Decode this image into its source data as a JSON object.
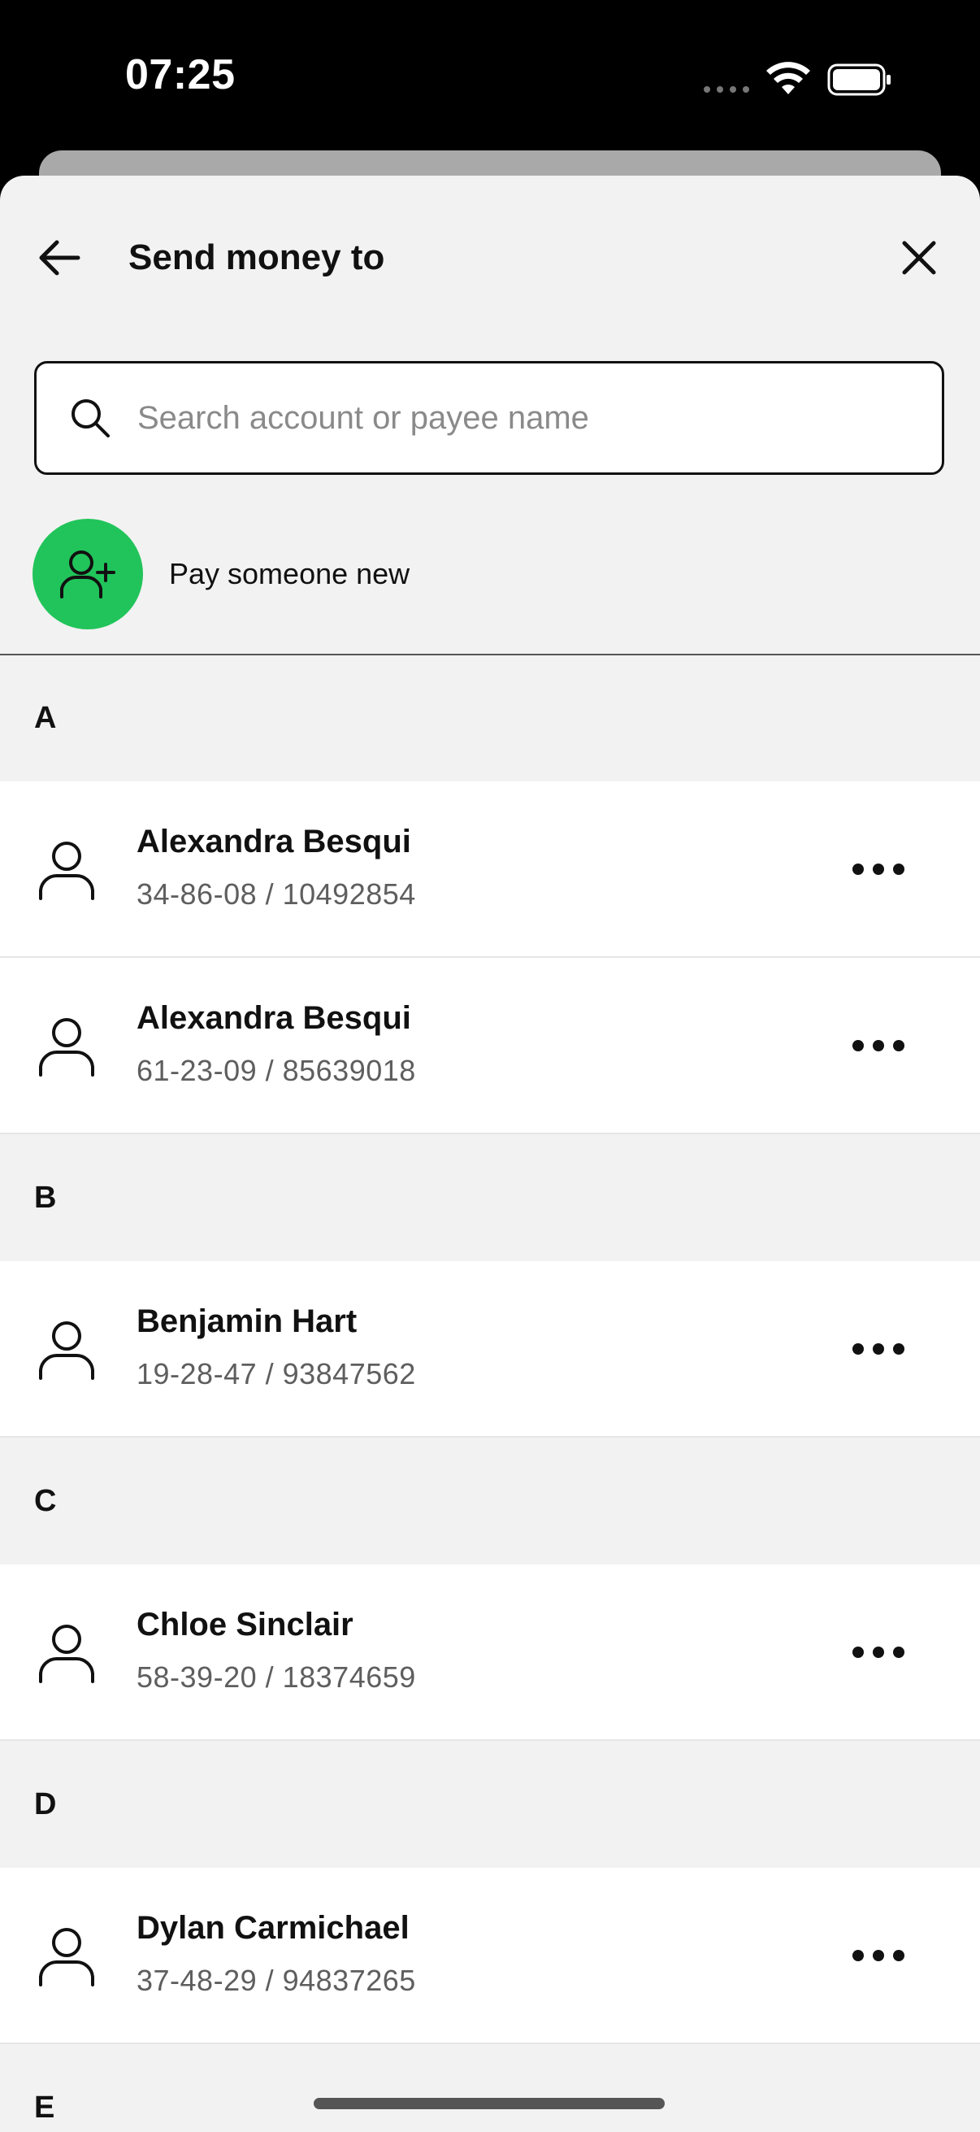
{
  "status_bar": {
    "time": "07:25",
    "icons": [
      "signal-dots-icon",
      "wifi-icon",
      "battery-icon"
    ]
  },
  "header": {
    "title": "Send money to",
    "back_icon": "arrow-left-icon",
    "close_icon": "close-icon"
  },
  "search": {
    "placeholder": "Search account or payee name",
    "value": "",
    "icon": "search-icon"
  },
  "pay_new": {
    "label": "Pay someone new",
    "icon": "add-user-icon",
    "color": "#21c45a"
  },
  "sections": [
    {
      "letter": "A",
      "payees": [
        {
          "name": "Alexandra Besqui",
          "account": "34-86-08 / 10492854"
        },
        {
          "name": "Alexandra Besqui",
          "account": "61-23-09 / 85639018"
        }
      ]
    },
    {
      "letter": "B",
      "payees": [
        {
          "name": "Benjamin Hart",
          "account": "19-28-47 / 93847562"
        }
      ]
    },
    {
      "letter": "C",
      "payees": [
        {
          "name": "Chloe Sinclair",
          "account": "58-39-20 / 18374659"
        }
      ]
    },
    {
      "letter": "D",
      "payees": [
        {
          "name": "Dylan Carmichael",
          "account": "37-48-29 / 94837265"
        }
      ]
    },
    {
      "letter": "E",
      "payees": []
    }
  ]
}
